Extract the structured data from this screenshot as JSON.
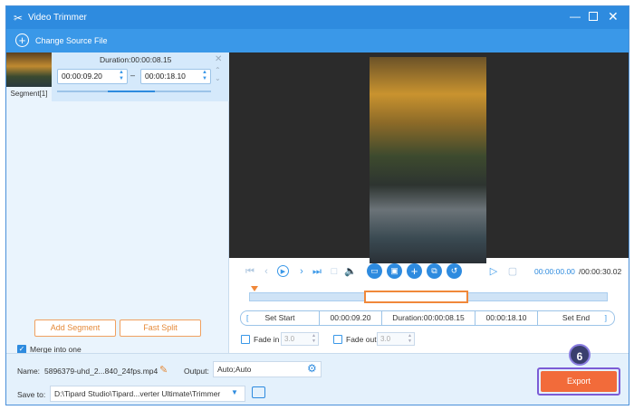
{
  "window": {
    "title": "Video Trimmer"
  },
  "toolbar": {
    "change_source": "Change Source File"
  },
  "segment": {
    "duration": "Duration:00:00:08.15",
    "start": "00:00:09.20",
    "end": "00:00:18.10",
    "dash": "–",
    "tab_label": "Segment[1]"
  },
  "left_actions": {
    "add_segment": "Add Segment",
    "fast_split": "Fast Split",
    "merge_label": "Merge into one",
    "merge_checked": true
  },
  "playback": {
    "current_time": "00:00:00.00",
    "total_time": "/00:00:30.02",
    "selection_start_fraction": 0.32,
    "selection_end_fraction": 0.61,
    "playhead_fraction": 0.0
  },
  "trim_bar": {
    "set_start": "Set Start",
    "start": "00:00:09.20",
    "duration": "Duration:00:00:08.15",
    "end": "00:00:18.10",
    "set_end": "Set End"
  },
  "fades": {
    "fade_in_label": "Fade in",
    "fade_in_value": "3.0",
    "fade_out_label": "Fade out",
    "fade_out_value": "3.0"
  },
  "bottom": {
    "name_label": "Name:",
    "name_value": "5896379-uhd_2...840_24fps.mp4",
    "output_label": "Output:",
    "output_value": "Auto;Auto",
    "save_label": "Save to:",
    "save_value": "D:\\Tipard Studio\\Tipard...verter Ultimate\\Trimmer",
    "export": "Export",
    "step_badge": "6"
  },
  "colors": {
    "accent": "#2e8bdf",
    "export": "#f26b3a",
    "highlight": "#7b5cd6"
  }
}
